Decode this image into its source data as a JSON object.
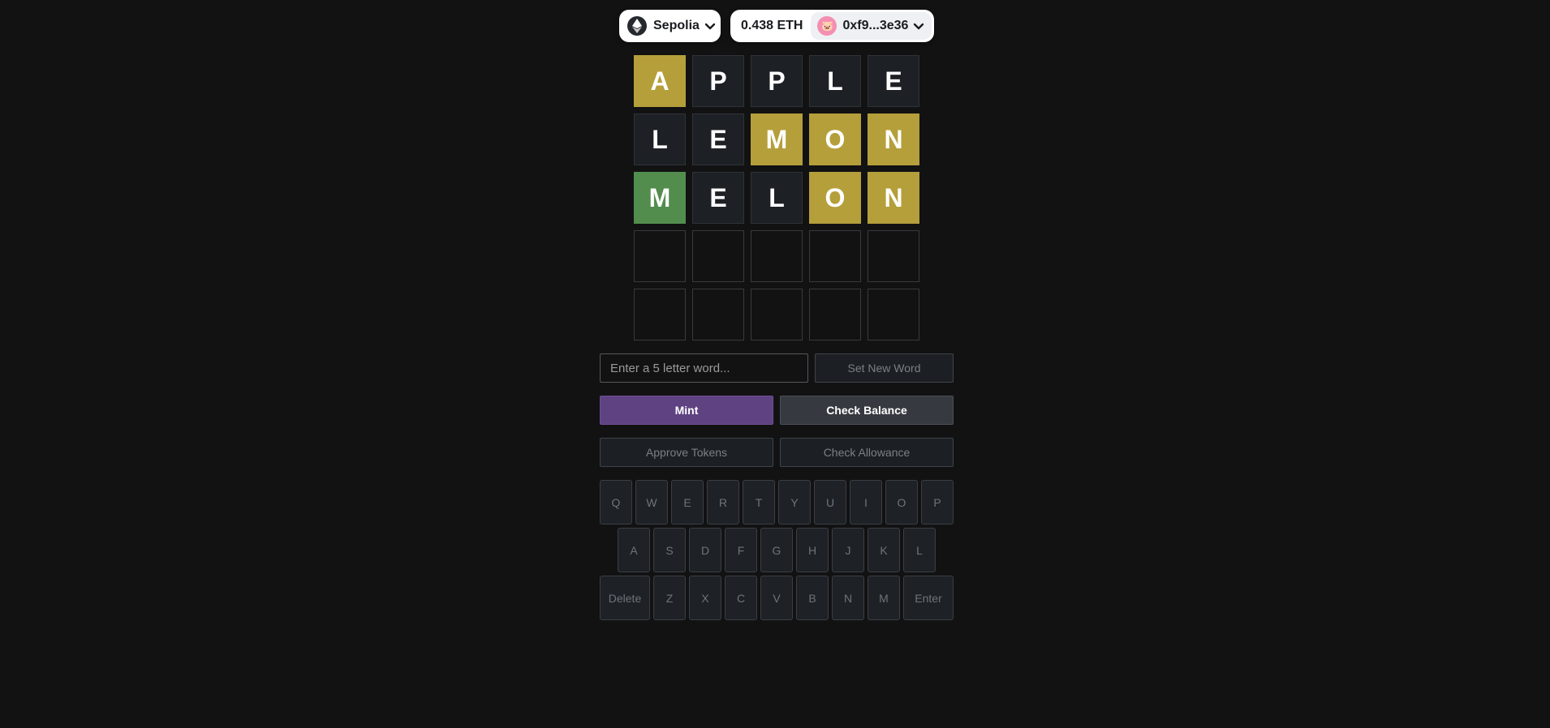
{
  "wallet": {
    "network": {
      "label": "Sepolia",
      "icon": "ethereum-icon"
    },
    "balance": "0.438 ETH",
    "address": "0xf9...3e36",
    "avatar_emoji": "🐷"
  },
  "board": {
    "rows": [
      {
        "letters": [
          "A",
          "P",
          "P",
          "L",
          "E"
        ],
        "states": [
          "present",
          "absent",
          "absent",
          "absent",
          "absent"
        ]
      },
      {
        "letters": [
          "L",
          "E",
          "M",
          "O",
          "N"
        ],
        "states": [
          "absent",
          "absent",
          "present",
          "present",
          "present"
        ]
      },
      {
        "letters": [
          "M",
          "E",
          "L",
          "O",
          "N"
        ],
        "states": [
          "correct",
          "absent",
          "absent",
          "present",
          "present"
        ]
      },
      {
        "letters": [
          "",
          "",
          "",
          "",
          ""
        ],
        "states": [
          "empty",
          "empty",
          "empty",
          "empty",
          "empty"
        ]
      },
      {
        "letters": [
          "",
          "",
          "",
          "",
          ""
        ],
        "states": [
          "empty",
          "empty",
          "empty",
          "empty",
          "empty"
        ]
      }
    ],
    "colors": {
      "present": "#b59f3b",
      "correct": "#538d4e",
      "absent": "#1d2025",
      "empty": "#121213"
    }
  },
  "controls": {
    "word_input": {
      "placeholder": "Enter a 5 letter word...",
      "value": ""
    },
    "set_new_word_label": "Set New Word",
    "mint_label": "Mint",
    "check_balance_label": "Check Balance",
    "approve_tokens_label": "Approve Tokens",
    "check_allowance_label": "Check Allowance",
    "mint_color": "#5f4282"
  },
  "keyboard": {
    "row1": [
      "Q",
      "W",
      "E",
      "R",
      "T",
      "Y",
      "U",
      "I",
      "O",
      "P"
    ],
    "row2": [
      "A",
      "S",
      "D",
      "F",
      "G",
      "H",
      "J",
      "K",
      "L"
    ],
    "row3": [
      "Delete",
      "Z",
      "X",
      "C",
      "V",
      "B",
      "N",
      "M",
      "Enter"
    ]
  }
}
